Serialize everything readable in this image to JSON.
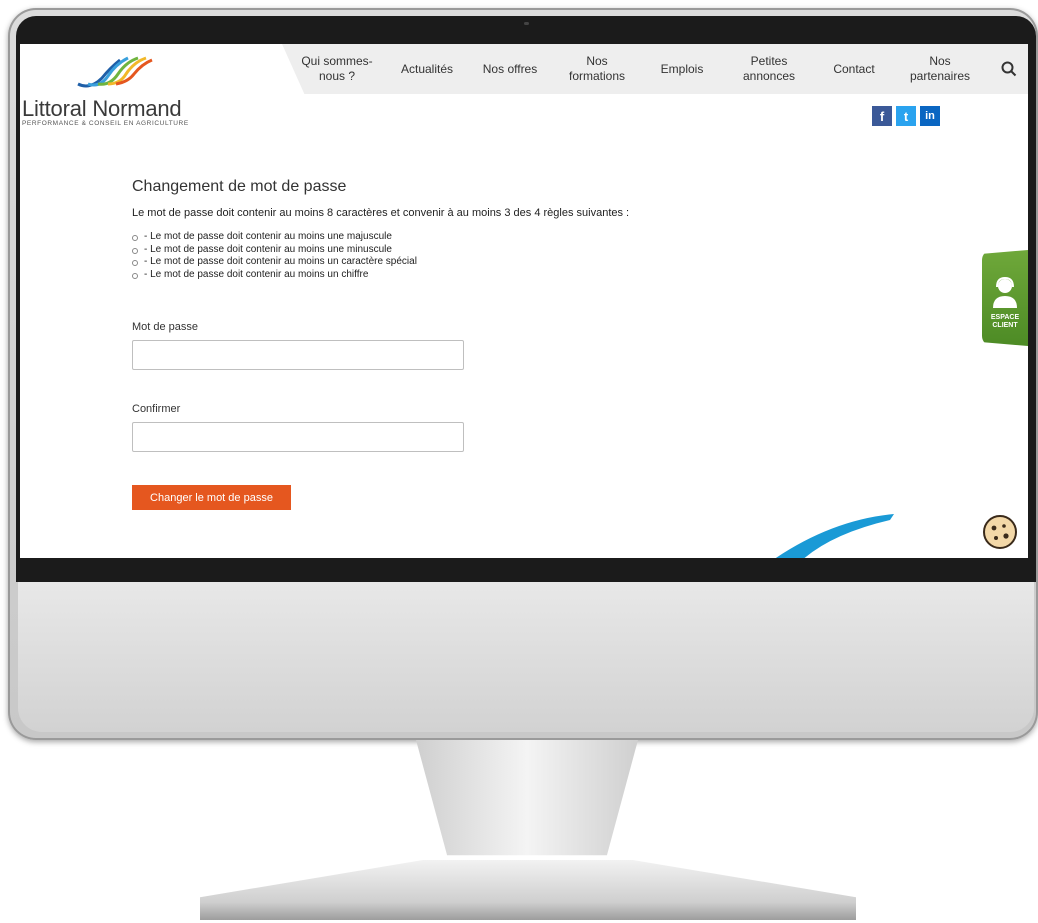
{
  "brand": {
    "name": "Littoral Normand",
    "tagline": "PERFORMANCE & CONSEIL EN AGRICULTURE"
  },
  "nav": {
    "items": [
      {
        "line1": "Qui sommes-",
        "line2": "nous ?"
      },
      {
        "line1": "Actualités",
        "line2": ""
      },
      {
        "line1": "Nos offres",
        "line2": ""
      },
      {
        "line1": "Nos",
        "line2": "formations"
      },
      {
        "line1": "Emplois",
        "line2": ""
      },
      {
        "line1": "Petites",
        "line2": "annonces"
      },
      {
        "line1": "Contact",
        "line2": ""
      },
      {
        "line1": "Nos",
        "line2": "partenaires"
      }
    ],
    "search_icon": "search-icon"
  },
  "social": {
    "facebook": "f",
    "twitter": "t",
    "linkedin": "in"
  },
  "form": {
    "title": "Changement de mot de passe",
    "intro": "Le mot de passe doit contenir au moins 8 caractères et convenir à au moins 3 des 4 règles suivantes :",
    "rules": [
      "- Le mot de passe doit contenir au moins une majuscule",
      "- Le mot de passe doit contenir au moins une minuscule",
      "- Le mot de passe doit contenir au moins un caractère spécial",
      "- Le mot de passe doit contenir au moins un chiffre"
    ],
    "password_label": "Mot de passe",
    "password_value": "",
    "confirm_label": "Confirmer",
    "confirm_value": "",
    "submit_label": "Changer le mot de passe"
  },
  "espace_client": {
    "line1": "ESPACE",
    "line2": "CLIENT"
  },
  "colors": {
    "accent": "#e5571f",
    "espace_green": "#5e9a2f",
    "nav_bg": "#eeeeee"
  }
}
